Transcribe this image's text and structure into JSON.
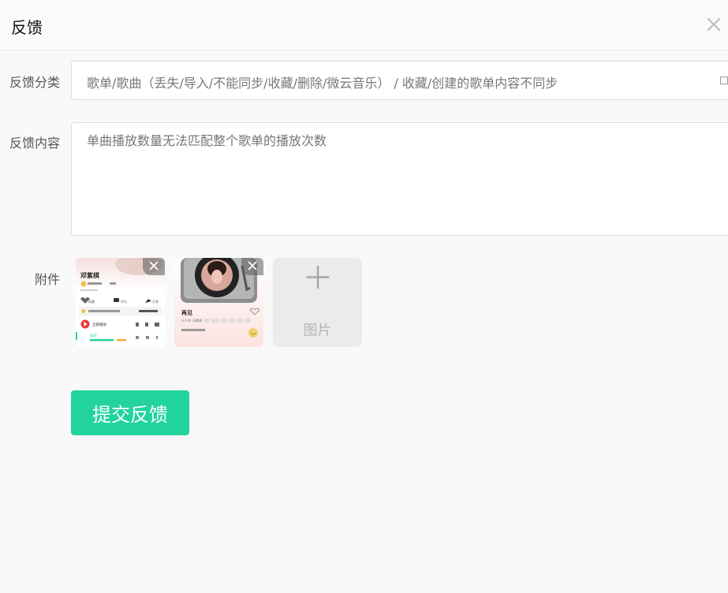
{
  "header": {
    "title": "反馈"
  },
  "form": {
    "category_label": "反馈分类",
    "category_value": "歌单/歌曲（丢失/导入/不能同步/收藏/删除/微云音乐） / 收藏/创建的歌单内容不同步",
    "content_label": "反馈内容",
    "content_value": "单曲播放数量无法匹配整个歌单的播放次数",
    "attachment_label": "附件",
    "add_image_label": "图片",
    "submit_label": "提交反馈"
  },
  "attachments": [
    {
      "artist": "邓紫棋",
      "like_label": "收藏",
      "comment_label": "评论",
      "share_label": "分享",
      "play_all_label": "全部播放",
      "song_title": "再见"
    },
    {
      "song_title": "再见",
      "artist_line": "G.E.M. 邓紫棋"
    }
  ],
  "colors": {
    "accent": "#22d39e",
    "page_bg": "#f9f9f9",
    "field_border": "#dcdcdc"
  }
}
